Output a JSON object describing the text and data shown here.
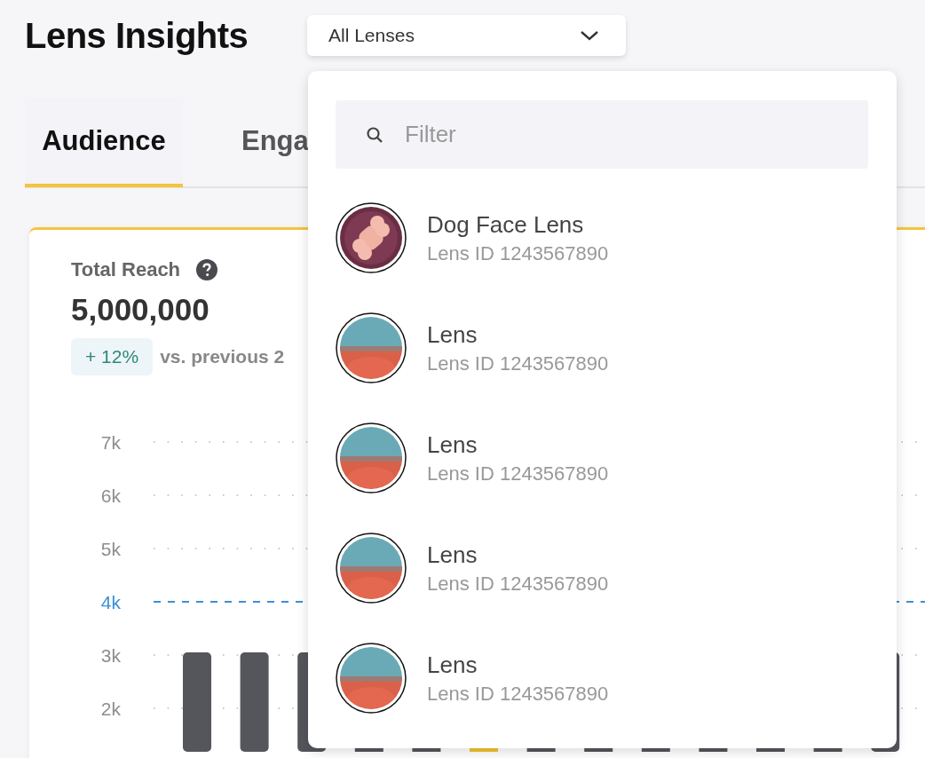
{
  "header": {
    "title": "Lens Insights",
    "lens_select": {
      "value": "All Lenses",
      "expanded": true
    }
  },
  "tabs": [
    {
      "label": "Audience",
      "selected": true
    },
    {
      "label": "Enga",
      "selected": false
    }
  ],
  "reach_card": {
    "label": "Total Reach",
    "value": "5,000,000",
    "change": "+ 12%",
    "comparison": "vs. previous 2",
    "y_axis_labels": [
      {
        "label": "7k",
        "highlighted": false
      },
      {
        "label": "6k",
        "highlighted": false
      },
      {
        "label": "5k",
        "highlighted": false
      },
      {
        "label": "4k",
        "highlighted": true
      },
      {
        "label": "3k",
        "highlighted": false
      },
      {
        "label": "2k",
        "highlighted": false
      }
    ],
    "bars": [
      {
        "highlighted": false
      },
      {
        "highlighted": false
      },
      {
        "highlighted": false
      },
      {
        "highlighted": false
      },
      {
        "highlighted": false
      },
      {
        "highlighted": true
      },
      {
        "highlighted": false
      },
      {
        "highlighted": false
      },
      {
        "highlighted": false
      },
      {
        "highlighted": false
      },
      {
        "highlighted": false
      },
      {
        "highlighted": false
      },
      {
        "highlighted": false
      }
    ]
  },
  "dropdown": {
    "filter": {
      "placeholder": "Filter"
    },
    "lenses": [
      {
        "name": "Dog Face Lens",
        "id": "Lens ID 1243567890",
        "selected": false
      },
      {
        "name": "Lens",
        "id": "Lens ID 1243567890",
        "selected": false
      },
      {
        "name": "Lens",
        "id": "Lens ID 1243567890",
        "selected": false
      },
      {
        "name": "Lens",
        "id": "Lens ID 1243567890",
        "selected": false
      },
      {
        "name": "Lens",
        "id": "Lens ID 1243567890",
        "selected": false
      }
    ]
  }
}
